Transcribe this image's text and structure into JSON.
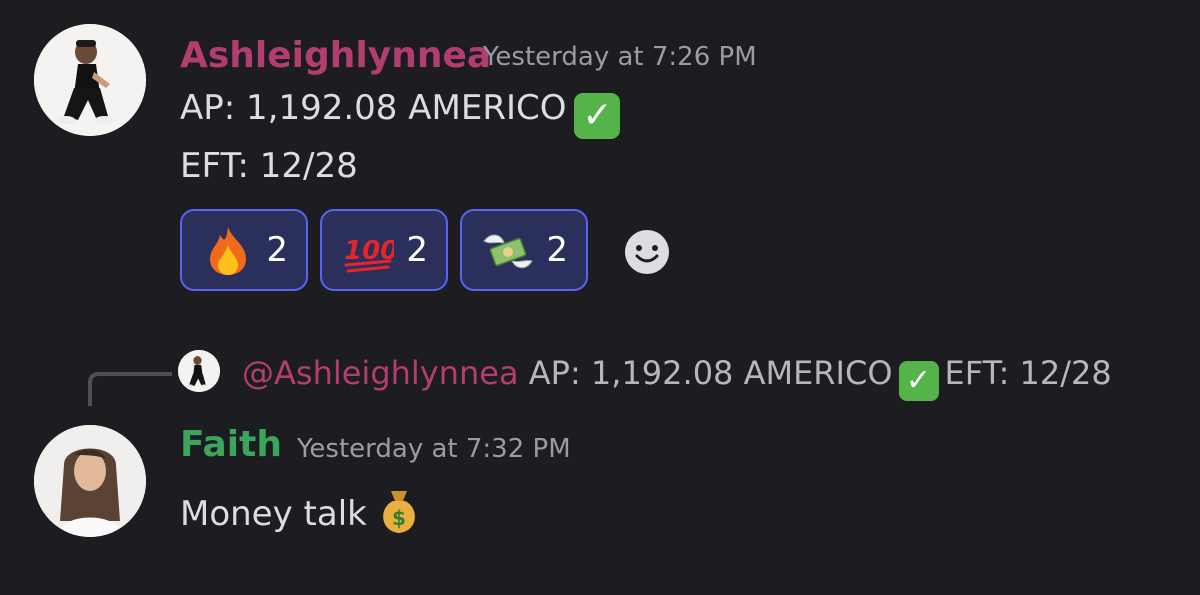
{
  "colors": {
    "background": "#1c1c21",
    "ashleigh_name": "#b23d6f",
    "faith_name": "#3ba55d",
    "timestamp": "#9a9ca3",
    "reaction_border": "#5865f2",
    "reaction_bg": "#2b2f5c"
  },
  "message1": {
    "username": "Ashleighlynnea",
    "timestamp": "Yesterday at 7:26 PM",
    "line1": "AP: 1,192.08 AMERICO",
    "line2": "EFT: 12/28",
    "reactions": [
      {
        "icon": "fire-emoji",
        "count": "2"
      },
      {
        "icon": "hundred-points-emoji",
        "count": "2"
      },
      {
        "icon": "money-with-wings-emoji",
        "count": "2"
      }
    ]
  },
  "reply": {
    "mention": "@Ashleighlynnea",
    "preview_before": "AP: 1,192.08 AMERICO",
    "preview_after": "EFT: 12/28"
  },
  "message2": {
    "username": "Faith",
    "timestamp": "Yesterday at 7:32 PM",
    "text": "Money talk"
  }
}
